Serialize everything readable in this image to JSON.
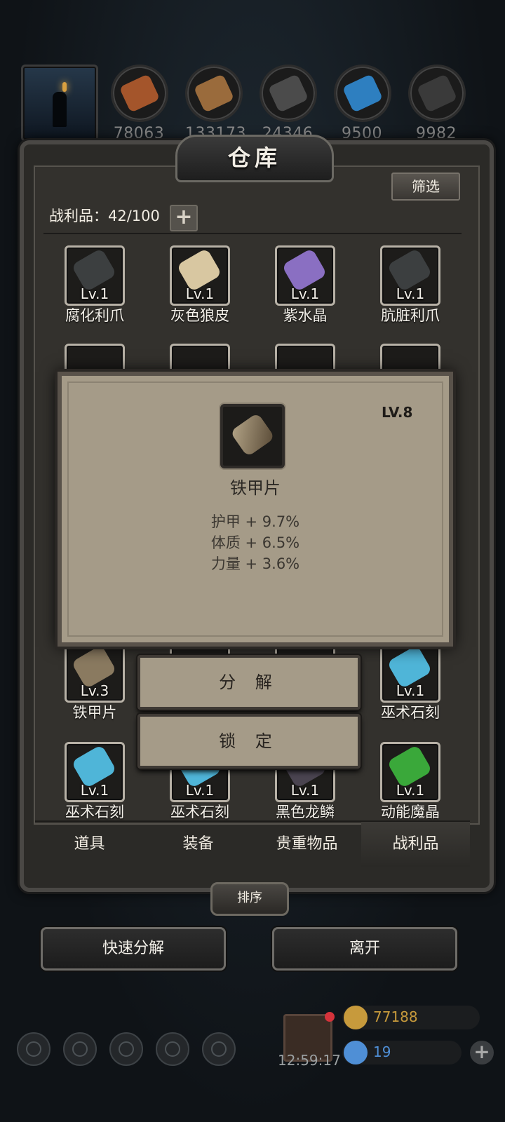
{
  "resources": [
    {
      "icon": "meat-icon",
      "value": "78063",
      "color": "#a4552b"
    },
    {
      "icon": "wood-icon",
      "value": "133173",
      "color": "#9a6b3c"
    },
    {
      "icon": "iron-icon",
      "value": "24346",
      "color": "#4b4b4b"
    },
    {
      "icon": "crystal-icon",
      "value": "9500",
      "color": "#2e7fc0"
    },
    {
      "icon": "stone-icon",
      "value": "9982",
      "color": "#3a3a3a"
    }
  ],
  "panel": {
    "title": "仓库",
    "filter_label": "筛选",
    "capacity_text": "战利品：42/100",
    "add_symbol": "+"
  },
  "items": [
    {
      "name": "腐化利爪",
      "level": "Lv.1",
      "icon": "claw-icon",
      "color": "#3c3f40"
    },
    {
      "name": "灰色狼皮",
      "level": "Lv.1",
      "icon": "fur-icon",
      "color": "#d8c7a1"
    },
    {
      "name": "紫水晶",
      "level": "Lv.1",
      "icon": "amethyst-icon",
      "color": "#8a6fc2"
    },
    {
      "name": "肮脏利爪",
      "level": "Lv.1",
      "icon": "claw-icon",
      "color": "#3c3f40"
    },
    {
      "name": "铁甲片",
      "level": "Lv.3",
      "icon": "armor-plate-icon",
      "color": "#8a7a60"
    },
    {
      "name": "巫术石刻",
      "level": "Lv.1",
      "icon": "rune-stone-icon",
      "color": "#4fb5d8"
    },
    {
      "name": "巫术石刻",
      "level": "Lv.1",
      "icon": "rune-stone-icon",
      "color": "#4fb5d8"
    },
    {
      "name": "巫术石刻",
      "level": "Lv.1",
      "icon": "rune-stone-icon",
      "color": "#4fb5d8"
    },
    {
      "name": "黑色龙鳞",
      "level": "Lv.1",
      "icon": "dragon-scale-icon",
      "color": "#4a4450"
    },
    {
      "name": "动能魔晶",
      "level": "Lv.1",
      "icon": "magic-crystal-icon",
      "color": "#3aa83a"
    }
  ],
  "popup": {
    "level": "LV.8",
    "item_name": "铁甲片",
    "stats": [
      "护甲 + 9.7%",
      "体质 + 6.5%",
      "力量 + 3.6%"
    ]
  },
  "actions": {
    "decompose": "分 解",
    "lock": "锁 定"
  },
  "tabs": [
    "道具",
    "装备",
    "贵重物品",
    "战利品"
  ],
  "active_tab": "战利品",
  "sort_label": "排序",
  "bottom_buttons": {
    "quick_decompose": "快速分解",
    "leave": "离开"
  },
  "footer": {
    "timer": "12:59:17",
    "gold": "77188",
    "gems": "19"
  },
  "colors": {
    "gold_text": "#c79a3c",
    "gem_text": "#4f8fd6"
  }
}
